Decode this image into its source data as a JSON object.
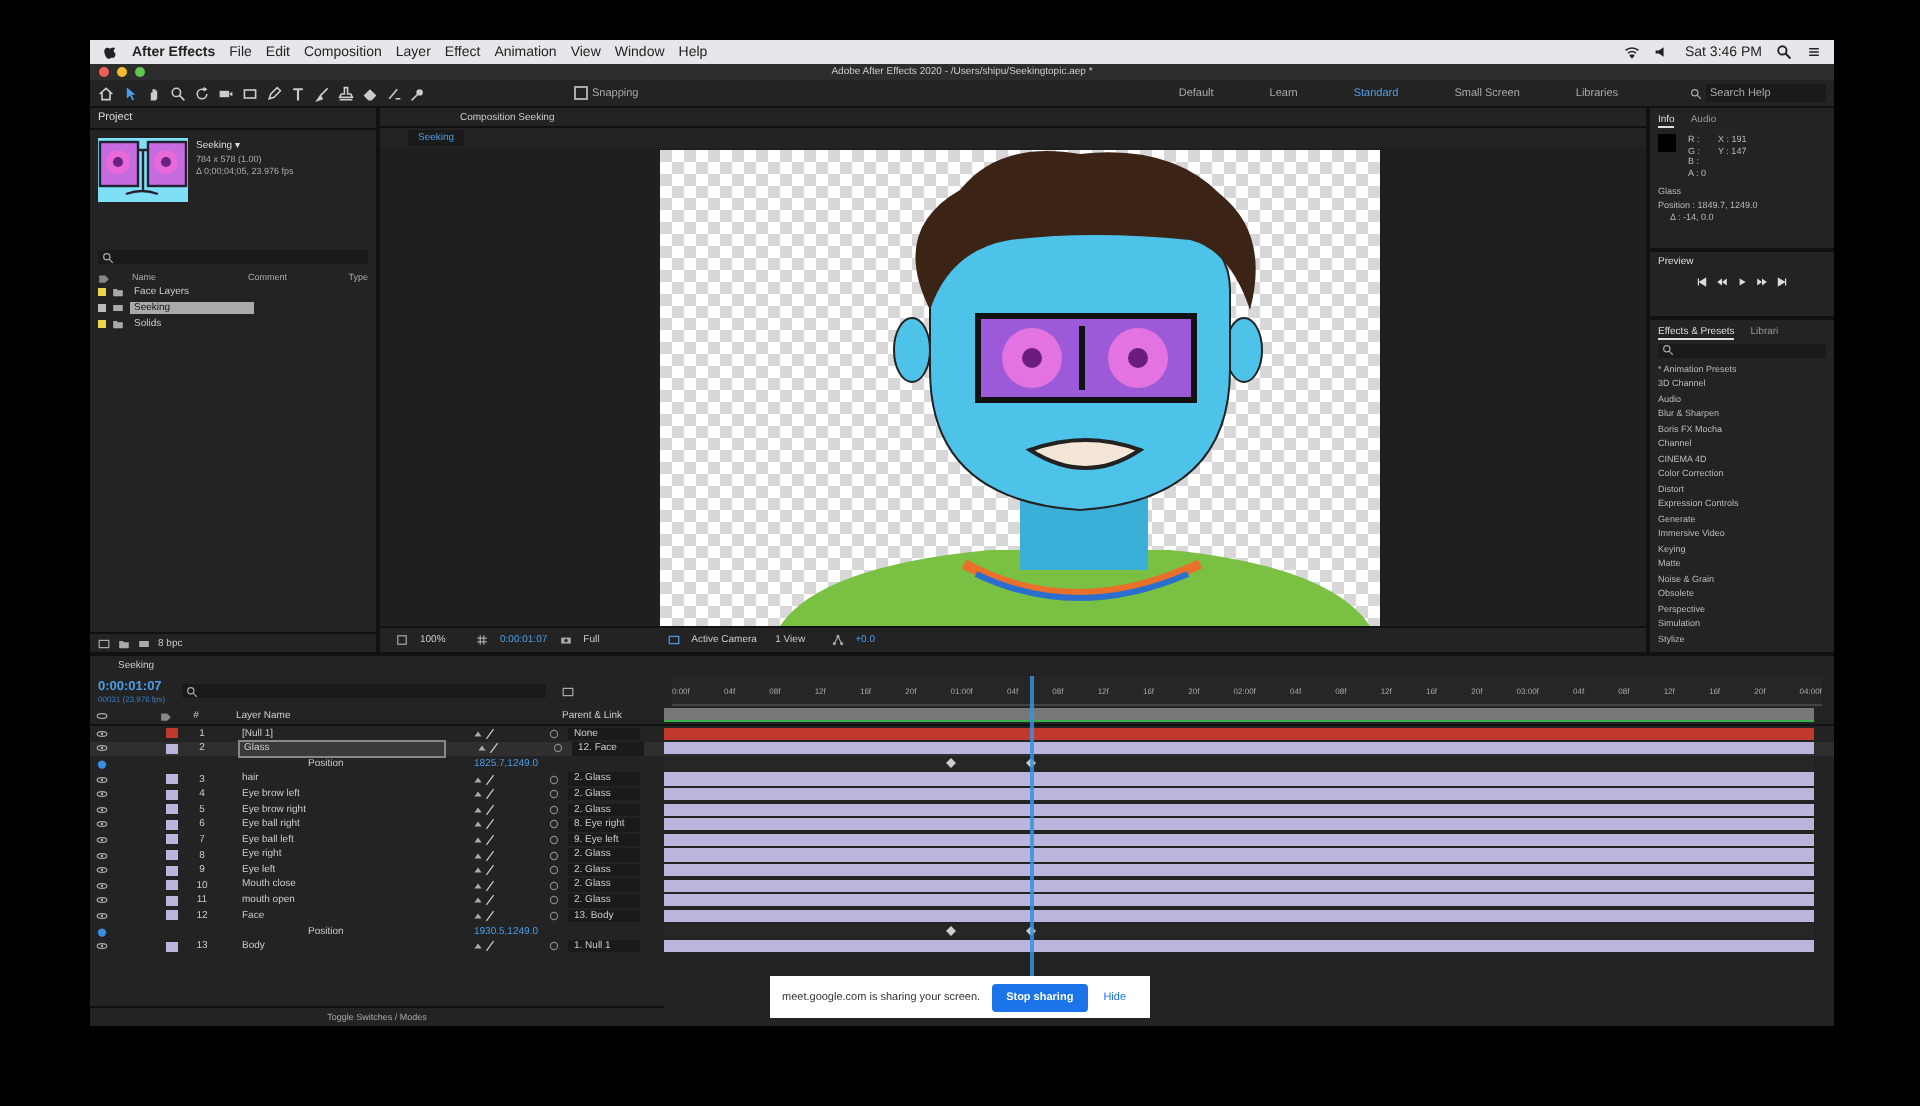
{
  "menubar": {
    "app": "After Effects",
    "items": [
      "File",
      "Edit",
      "Composition",
      "Layer",
      "Effect",
      "Animation",
      "View",
      "Window",
      "Help"
    ],
    "clock": "Sat 3:46 PM"
  },
  "window": {
    "title": "Adobe After Effects 2020 - /Users/shipu/Seekingtopic.aep *"
  },
  "toolbar": {
    "snapping": {
      "label": "Snapping",
      "checked": false
    },
    "workspaces": [
      {
        "label": "Default",
        "selected": false
      },
      {
        "label": "Learn",
        "selected": false
      },
      {
        "label": "Standard",
        "selected": true
      },
      {
        "label": "Small Screen",
        "selected": false
      },
      {
        "label": "Libraries",
        "selected": false
      }
    ],
    "search": {
      "placeholder": "Search Help"
    }
  },
  "project": {
    "title": "Project",
    "comp_name": "Seeking ▾",
    "comp_size": "784 x 578 (1.00)",
    "comp_duration": "Δ 0;00;04;05, 23.976 fps",
    "columns": [
      "Name",
      "Comment",
      "Type"
    ],
    "items": [
      {
        "name": "Face Layers",
        "kind": "folder",
        "selected": false
      },
      {
        "name": "Seeking",
        "kind": "comp",
        "selected": true
      },
      {
        "name": "Solids",
        "kind": "folder",
        "selected": false
      }
    ],
    "bpc": "8 bpc"
  },
  "viewer": {
    "tab": "Composition Seeking",
    "subtab": "Seeking",
    "zoom": "100%",
    "timecode": "0:00:01:07",
    "resolution": "Full",
    "camera": "Active Camera",
    "views": "1 View",
    "exposure": "+0.0"
  },
  "info": {
    "tabs": [
      {
        "label": "Info",
        "selected": true
      },
      {
        "label": "Audio",
        "selected": false
      }
    ],
    "channels": [
      "R :",
      "G :",
      "B :",
      "A : 0"
    ],
    "coords": [
      "X : 191",
      "Y : 147"
    ],
    "layer": "Glass",
    "position": "Position : 1849.7, 1249.0",
    "delta": "Δ : -14, 0.0"
  },
  "preview": {
    "title": "Preview"
  },
  "effects": {
    "tabs": [
      {
        "label": "Effects & Presets",
        "selected": true
      },
      {
        "label": "Librari",
        "selected": false
      }
    ],
    "items": [
      "* Animation Presets",
      "3D Channel",
      "Audio",
      "Blur & Sharpen",
      "Boris FX Mocha",
      "Channel",
      "CINEMA 4D",
      "Color Correction",
      "Distort",
      "Expression Controls",
      "Generate",
      "Immersive Video",
      "Keying",
      "Matte",
      "Noise & Grain",
      "Obsolete",
      "Perspective",
      "Simulation",
      "Stylize"
    ]
  },
  "timeline": {
    "tab": "Seeking",
    "timecode": "0:00:01:07",
    "fps": "00031 (23.976 fps)",
    "columns": {
      "number": "#",
      "layer_name": "Layer Name",
      "parent": "Parent & Link"
    },
    "ruler": [
      "0:00f",
      "04f",
      "08f",
      "12f",
      "16f",
      "20f",
      "01:00f",
      "04f",
      "08f",
      "12f",
      "16f",
      "20f",
      "02:00f",
      "04f",
      "08f",
      "12f",
      "16f",
      "20f",
      "03:00f",
      "04f",
      "08f",
      "12f",
      "16f",
      "20f",
      "04:00f"
    ],
    "playhead": {
      "level": 0.32
    },
    "layers": [
      {
        "kind": "layer",
        "number": "1",
        "name": "[Null 1]",
        "parent": "None",
        "color": "#c0392b",
        "selected": false
      },
      {
        "kind": "layer",
        "number": "2",
        "name": "Glass",
        "parent": "12. Face",
        "color": "#b9b5dc",
        "selected": true
      },
      {
        "kind": "property",
        "name": "Position",
        "value": "1825.7,1249.0",
        "keyframes": [
          {
            "level": 0.25
          },
          {
            "level": 0.32
          }
        ]
      },
      {
        "kind": "layer",
        "number": "3",
        "name": "hair",
        "parent": "2. Glass",
        "color": "#b9b5dc",
        "selected": false
      },
      {
        "kind": "layer",
        "number": "4",
        "name": "Eye brow left",
        "parent": "2. Glass",
        "color": "#b9b5dc",
        "selected": false
      },
      {
        "kind": "layer",
        "number": "5",
        "name": "Eye brow right",
        "parent": "2. Glass",
        "color": "#b9b5dc",
        "selected": false
      },
      {
        "kind": "layer",
        "number": "6",
        "name": "Eye ball right",
        "parent": "8. Eye right",
        "color": "#b9b5dc",
        "selected": false
      },
      {
        "kind": "layer",
        "number": "7",
        "name": "Eye ball left",
        "parent": "9. Eye left",
        "color": "#b9b5dc",
        "selected": false
      },
      {
        "kind": "layer",
        "number": "8",
        "name": "Eye right",
        "parent": "2. Glass",
        "color": "#b9b5dc",
        "selected": false
      },
      {
        "kind": "layer",
        "number": "9",
        "name": "Eye left",
        "parent": "2. Glass",
        "color": "#b9b5dc",
        "selected": false
      },
      {
        "kind": "layer",
        "number": "10",
        "name": "Mouth close",
        "parent": "2. Glass",
        "color": "#b9b5dc",
        "selected": false
      },
      {
        "kind": "layer",
        "number": "11",
        "name": "mouth open",
        "parent": "2. Glass",
        "color": "#b9b5dc",
        "selected": false
      },
      {
        "kind": "layer",
        "number": "12",
        "name": "Face",
        "parent": "13. Body",
        "color": "#b9b5dc",
        "selected": false
      },
      {
        "kind": "property",
        "name": "Position",
        "value": "1930.5,1249.0",
        "keyframes": [
          {
            "level": 0.25
          },
          {
            "level": 0.32
          }
        ]
      },
      {
        "kind": "layer",
        "number": "13",
        "name": "Body",
        "parent": "1. Null 1",
        "color": "#b9b5dc",
        "selected": false
      }
    ],
    "footer": "Toggle Switches / Modes"
  },
  "share_banner": {
    "message": "meet.google.com is sharing your screen.",
    "stop": "Stop sharing",
    "hide": "Hide"
  }
}
